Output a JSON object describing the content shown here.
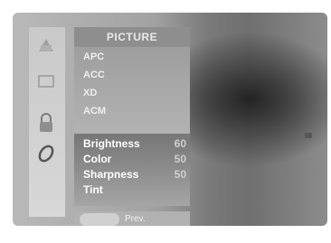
{
  "menu": {
    "title": "PICTURE",
    "items": [
      "APC",
      "ACC",
      "XD",
      "ACM"
    ]
  },
  "adjustments": [
    {
      "label": "Brightness",
      "value": "60"
    },
    {
      "label": "Color",
      "value": "50"
    },
    {
      "label": "Sharpness",
      "value": "50"
    },
    {
      "label": "Tint",
      "value": ""
    }
  ],
  "footer": {
    "prev_label": "Prev."
  },
  "icons": [
    "picture-menu-icon",
    "screen-icon",
    "lock-icon",
    "option-icon"
  ]
}
